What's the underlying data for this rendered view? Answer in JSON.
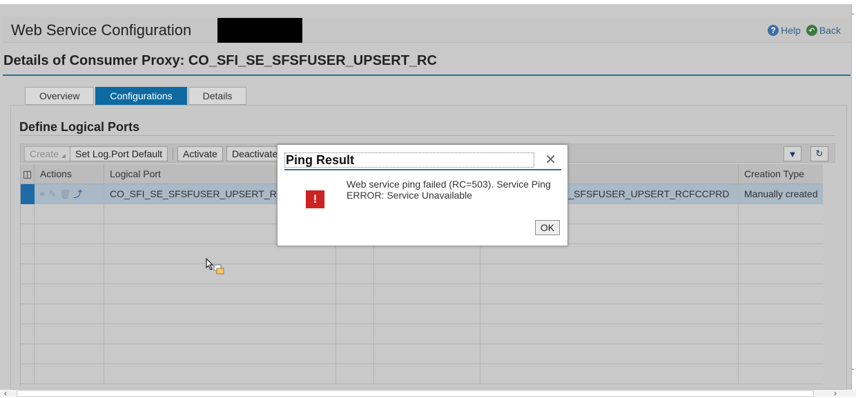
{
  "app": {
    "title": "Web Service Configuration",
    "help_label": "Help",
    "back_label": "Back"
  },
  "proxy": {
    "title": "Details of Consumer Proxy: CO_SFI_SE_SFSFUSER_UPSERT_RC"
  },
  "tabs": [
    {
      "label": "Overview",
      "active": false
    },
    {
      "label": "Configurations",
      "active": true
    },
    {
      "label": "Details",
      "active": false
    }
  ],
  "section": {
    "title": "Define Logical Ports"
  },
  "toolbar": {
    "create_label": "Create",
    "set_default_label": "Set Log.Port Default",
    "activate_label": "Activate",
    "deactivate_label": "Deactivate",
    "filter_icon": "filter-icon",
    "settings_icon": "table-settings-icon"
  },
  "grid": {
    "columns": [
      "Actions",
      "Logical Port",
      "",
      "",
      "",
      "Creation Type"
    ],
    "rows": [
      {
        "logical_port": "CO_SFI_SE_SFSFUSER_UPSERT_R",
        "col_right": "E_SFSFUSER_UPSERT_RCFCCPRD",
        "creation_type": "Manually created",
        "selected": true
      }
    ],
    "empty_rows": 9
  },
  "modal": {
    "title": "Ping Result",
    "message_line1": "Web service ping failed (RC=503). Service Ping",
    "message_line2": "ERROR: Service Unavailable",
    "ok_label": "OK",
    "icon": "error-icon"
  },
  "colors": {
    "accent": "#0d6aa1",
    "error": "#cc2222"
  }
}
